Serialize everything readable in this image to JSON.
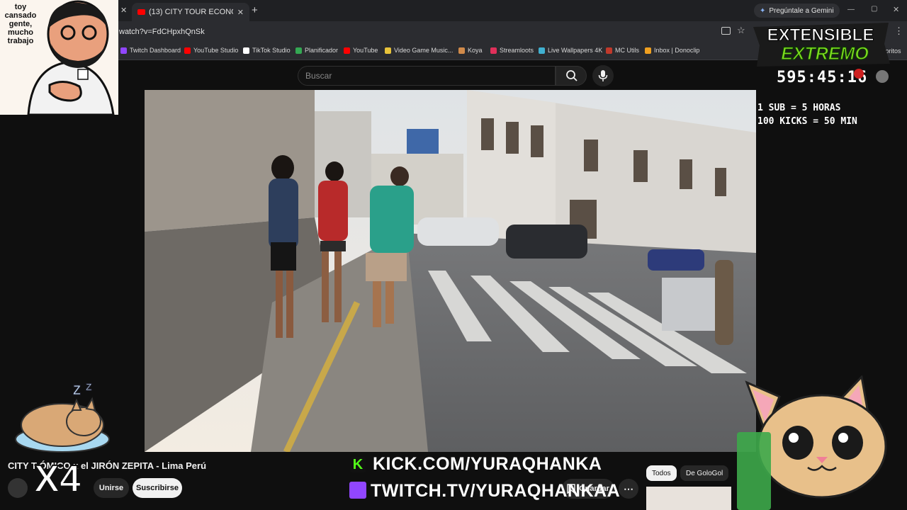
{
  "browser": {
    "tabs": [
      {
        "label": "(13) CITY TOUR ECONÓMI"
      }
    ],
    "address": "watch?v=FdCHpxhQnSk",
    "gemini_label": "Pregúntale a Gemini",
    "bookmarks": [
      {
        "label": "Twitch Dashboard",
        "color": "#9146ff"
      },
      {
        "label": "YouTube Studio",
        "color": "#ff0000"
      },
      {
        "label": "TikTok Studio",
        "color": "#ffffff"
      },
      {
        "label": "Planificador",
        "color": "#34a853"
      },
      {
        "label": "YouTube",
        "color": "#ff0000"
      },
      {
        "label": "Video Game Music...",
        "color": "#e8c33a"
      },
      {
        "label": "Koya",
        "color": "#d08a4a"
      },
      {
        "label": "Streamloots",
        "color": "#e0305a"
      },
      {
        "label": "Live Wallpapers 4K",
        "color": "#40b0d0"
      },
      {
        "label": "MC Utils",
        "color": "#c0392b"
      },
      {
        "label": "Inbox | Donoclip",
        "color": "#f0a020"
      }
    ],
    "bookmarks_overflow": "avoritos"
  },
  "youtube": {
    "search_placeholder": "Buscar",
    "video_title": "CITY T           ÓMICO x el JIRÓN ZEPITA - Lima Perú",
    "join_label": "Unirse",
    "subscribe_label": "Suscribirse",
    "save_label": "Guardar",
    "chips": [
      "Todos",
      "De GoloGol"
    ]
  },
  "overlay": {
    "webcam_caption": "toy cansado gente, mucho trabajo",
    "extensible_line1": "EXTENSIBLE",
    "extensible_line2": "EXTREMO",
    "timer": "595:45:16",
    "rule1": "1 SUB = 5 HORAS",
    "rule2": "100 KICKS = 50 MIN",
    "multiplier": "X4",
    "kick_url": "KICK.COM/YURAQHANKA",
    "twitch_url": "TWITCH.TV/YURAQHANKAA",
    "colors": {
      "kick": "#53fc18",
      "twitch": "#9146ff",
      "extensible": "#7ddc1f"
    }
  }
}
